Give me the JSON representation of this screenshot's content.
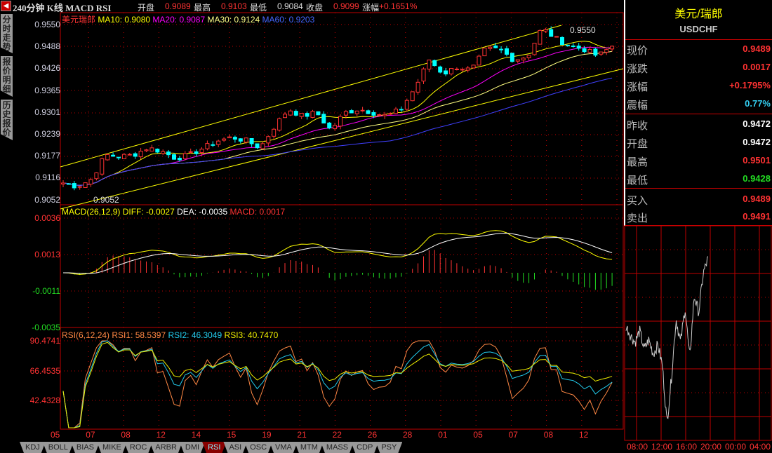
{
  "header": {
    "title": "240分钟 K线 MACD RSI",
    "open_label": "开盘",
    "open": "0.9089",
    "high_label": "最高",
    "high": "0.9103",
    "low_label": "最低",
    "low": "0.9084",
    "close_label": "收盘",
    "close": "0.9099",
    "change_label": "涨幅",
    "change": "+0.1651%"
  },
  "side_tabs": [
    "分时走势",
    "报价明细",
    "历史报价"
  ],
  "price_legend": {
    "name": "美元瑞郎",
    "ma10": "MA10: 0.9080",
    "ma20": "MA20: 0.9087",
    "ma30": "MA30: 0.9124",
    "ma60": "MA60: 0.9203",
    "high_mark": "0.9550",
    "low_mark": "0.9052"
  },
  "price_axis": [
    "0.9550",
    "0.9488",
    "0.9426",
    "0.9365",
    "0.9301",
    "0.9239",
    "0.9177",
    "0.9116",
    "0.9052"
  ],
  "macd_legend": {
    "label": "MACD(26,12,9)",
    "diff": "DIFF: -0.0027",
    "dea": "DEA: -0.0035",
    "macd": "MACD: 0.0017"
  },
  "macd_axis": [
    "0.0036",
    "0.0013",
    "-0.0011",
    "-0.0035"
  ],
  "rsi_legend": {
    "label": "RSI(6,12,24)",
    "rsi1": "RSI1: 58.5397",
    "rsi2": "RSI2: 46.3049",
    "rsi3": "RSI3: 40.7470"
  },
  "rsi_axis": [
    "90.4741",
    "66.4535",
    "42.4328"
  ],
  "x_axis": [
    "05",
    "07",
    "08",
    "12",
    "14",
    "15",
    "19",
    "21",
    "22",
    "26",
    "28",
    "01",
    "05",
    "07",
    "08",
    "12"
  ],
  "bottom_tabs": [
    "KDJ",
    "BOLL",
    "BIAS",
    "MIKE",
    "ROC",
    "ARBR",
    "DMI",
    "RSI",
    "ASI",
    "OSC",
    "VMA",
    "MTM",
    "MASS",
    "CDP",
    "PSY"
  ],
  "active_tab": "RSI",
  "quote": {
    "name": "美元/瑞郎",
    "symbol": "USDCHF",
    "rows": [
      {
        "k": "现价",
        "v": "0.9489",
        "c": "#ff3232"
      },
      {
        "k": "涨跌",
        "v": "0.0017",
        "c": "#ff3232"
      },
      {
        "k": "涨幅",
        "v": "+0.1795%",
        "c": "#ff3232"
      },
      {
        "k": "震幅",
        "v": "0.77%",
        "c": "#33ccee"
      },
      {
        "k": "昨收",
        "v": "0.9472",
        "c": "#ffffff"
      },
      {
        "k": "开盘",
        "v": "0.9472",
        "c": "#ffffff"
      },
      {
        "k": "最高",
        "v": "0.9501",
        "c": "#ff3232"
      },
      {
        "k": "最低",
        "v": "0.9428",
        "c": "#22dd22"
      },
      {
        "k": "买入",
        "v": "0.9489",
        "c": "#ff3232"
      },
      {
        "k": "卖出",
        "v": "0.9491",
        "c": "#ff3232"
      }
    ]
  },
  "intraday_axis": [
    "08:00",
    "12:00",
    "16:00",
    "20:00",
    "00:00",
    "04:00"
  ],
  "colors": {
    "up": "#ff3232",
    "down": "#00ffff",
    "grid": "#c00000",
    "ma10": "#ffff00",
    "ma20": "#ff00ff",
    "ma30": "#ffff80",
    "ma60": "#4040ff"
  },
  "chart_data": {
    "type": "candlestick",
    "ylim": [
      0.9052,
      0.955
    ],
    "close_anchors": [
      0.91,
      0.909,
      0.911,
      0.918,
      0.9175,
      0.918,
      0.92,
      0.919,
      0.917,
      0.918,
      0.92,
      0.922,
      0.923,
      0.922,
      0.92,
      0.926,
      0.931,
      0.929,
      0.93,
      0.925,
      0.93,
      0.931,
      0.93,
      0.929,
      0.931,
      0.937,
      0.945,
      0.941,
      0.943,
      0.942,
      0.948,
      0.948,
      0.945,
      0.946,
      0.954,
      0.951,
      0.949,
      0.948,
      0.946,
      0.9489
    ],
    "intraday_anchors": [
      0.9472,
      0.9468,
      0.9465,
      0.947,
      0.9462,
      0.9466,
      0.946,
      0.9464,
      0.9455,
      0.943,
      0.945,
      0.9475,
      0.9465,
      0.948,
      0.9458,
      0.9485,
      0.9478,
      0.9495,
      0.9501
    ]
  }
}
